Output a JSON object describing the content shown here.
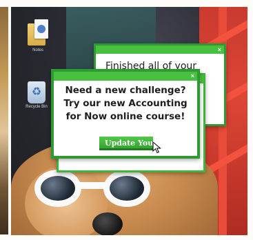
{
  "desktop": {
    "icons": [
      {
        "label": "Notes",
        "icon": "folder-document-icon"
      },
      {
        "label": "Recycle Bin",
        "icon": "recycle-bin-icon"
      }
    ]
  },
  "popups": {
    "back": {
      "message": "Finished all of your",
      "close_label": "×"
    },
    "middle": {
      "close_label": "×"
    },
    "front": {
      "message_lines": [
        "Need a new challenge?",
        "Try our new Accounting",
        "for Now online course!"
      ],
      "button_label": "Update You",
      "close_label": "×"
    }
  },
  "colors": {
    "popup_border": "#2f9a34",
    "popup_titlebar": "#47c13f",
    "button": "#3aae33",
    "chair": "#d8432f"
  }
}
